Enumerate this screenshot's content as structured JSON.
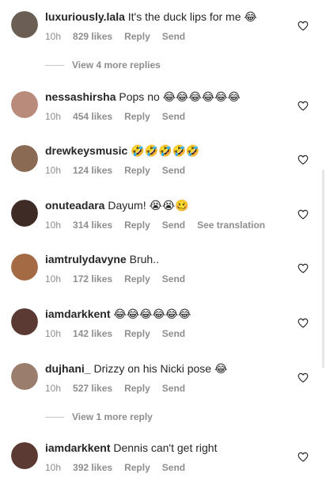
{
  "comments": [
    {
      "username": "luxuriously.lala",
      "text": "It's the duck lips for me 😂",
      "time": "10h",
      "likes": "829 likes",
      "reply": "Reply",
      "send": "Send",
      "avatar_color": "#6b5f55"
    },
    {
      "username": "nessashirsha",
      "text": "Pops no 😂😂😂😂😂😂",
      "time": "10h",
      "likes": "454 likes",
      "reply": "Reply",
      "send": "Send",
      "avatar_color": "#b88b7a"
    },
    {
      "username": "drewkeysmusic",
      "text": "🤣🤣🤣🤣🤣",
      "time": "10h",
      "likes": "124 likes",
      "reply": "Reply",
      "send": "Send",
      "avatar_color": "#8a6a52"
    },
    {
      "username": "onuteadara",
      "text": "Dayum! 😭😭🥴",
      "time": "10h",
      "likes": "314 likes",
      "reply": "Reply",
      "send": "Send",
      "extra": "See translation",
      "avatar_color": "#3f2b25"
    },
    {
      "username": "iamtrulydavyne",
      "text": "Bruh..",
      "time": "10h",
      "likes": "172 likes",
      "reply": "Reply",
      "send": "Send",
      "avatar_color": "#a36a43"
    },
    {
      "username": "iamdarkkent",
      "text": "😂😂😂😂😂😂",
      "time": "10h",
      "likes": "142 likes",
      "reply": "Reply",
      "send": "Send",
      "avatar_color": "#5a3a32"
    },
    {
      "username": "dujhani_",
      "text": "Drizzy on his Nicki pose 😂",
      "time": "10h",
      "likes": "527 likes",
      "reply": "Reply",
      "send": "Send",
      "avatar_color": "#9a7d6c"
    },
    {
      "username": "iamdarkkent",
      "text": "Dennis can't get right",
      "time": "10h",
      "likes": "392 likes",
      "reply": "Reply",
      "send": "Send",
      "avatar_color": "#5a3a32"
    }
  ],
  "view_more_1": "View 4 more replies",
  "view_more_2": "View 1 more reply",
  "colors": {
    "secondary_text": "#8e8e8e",
    "primary_text": "#262626"
  }
}
